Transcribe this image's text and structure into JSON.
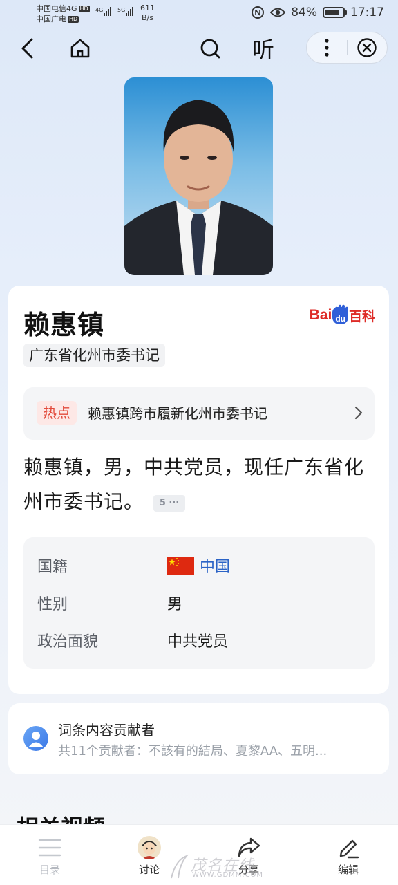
{
  "status_bar": {
    "carrier_1": "中国电信4G",
    "carrier_2": "中国广电",
    "hd": "HD",
    "net_4g": "4G",
    "net_5g": "5G",
    "net_speed_value": "611",
    "net_speed_unit": "B/s",
    "battery": "84%",
    "battery_level": 0.84,
    "time": "17:17"
  },
  "nav": {
    "listen_label": "听"
  },
  "entry": {
    "name": "赖惠镇",
    "role_tag": "广东省化州市委书记",
    "brand": {
      "bai": "Bai",
      "du": "du",
      "ke": "百科"
    },
    "hot": {
      "tag": "热点",
      "text": "赖惠镇跨市履新化州市委书记"
    },
    "summary": "赖惠镇，男，中共党员，现任广东省化州市委书记。",
    "ref_badge": "5 ···",
    "info": [
      {
        "label": "国籍",
        "value": "中国"
      },
      {
        "label": "性别",
        "value": "男"
      },
      {
        "label": "政治面貌",
        "value": "中共党员"
      }
    ]
  },
  "contributors": {
    "title": "词条内容贡献者",
    "subtitle": "共11个贡献者：不該有的結局、夏黎AA、五明..."
  },
  "section_title": "相关视频",
  "tabs": [
    {
      "label": "目录",
      "icon": "list-icon"
    },
    {
      "label": "讨论",
      "icon": "avatar-icon"
    },
    {
      "label": "分享",
      "icon": "share-icon"
    },
    {
      "label": "编辑",
      "icon": "edit-icon"
    }
  ],
  "watermark": {
    "text": "茂名在线",
    "url": "WWW.GDMM.COM"
  },
  "colors": {
    "hot_tag": "#e24a3b",
    "link": "#2b63c6",
    "brand_red": "#de2b27",
    "brand_blue": "#2f5fd8"
  }
}
